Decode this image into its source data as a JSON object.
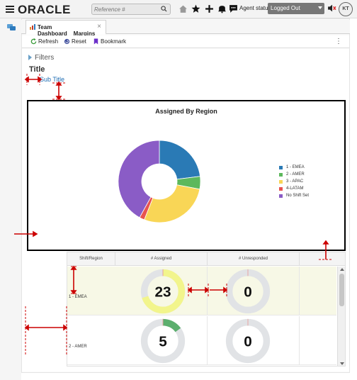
{
  "header": {
    "logo": "ORACLE",
    "search_placeholder": "Reference #",
    "agent_label": "Agent status:",
    "agent_status": "Logged Out",
    "avatar_initials": "KT"
  },
  "tab": {
    "label": "Team Dashboard__Margins",
    "close": "×"
  },
  "toolbar": {
    "refresh": "Refresh",
    "reset": "Reset",
    "bookmark": "Bookmark"
  },
  "filters_label": "Filters",
  "title": "Title",
  "subtitle": "Sub Title",
  "chart_data": {
    "type": "pie",
    "title": "Assigned By Region",
    "donut": true,
    "legend_position": "right",
    "categories": [
      "1 - EMEA",
      "2 - AMER",
      "3 - APAC",
      "4-LATAM",
      "No Shift Set"
    ],
    "values": [
      23,
      5,
      28,
      2,
      42
    ],
    "colors": [
      "#2a7ab5",
      "#5cb85c",
      "#f9d656",
      "#e8534f",
      "#8a5cc6"
    ]
  },
  "table": {
    "headers": [
      "Shift/Region",
      "# Assigned",
      "# Unresponded"
    ],
    "rows": [
      {
        "region": "1 - EMEA",
        "assigned": "23",
        "unresponded": "0",
        "assigned_fill": 0.7,
        "assigned_color": "#f2f58c",
        "highlight": "#f7f8e6"
      },
      {
        "region": "2 - AMER",
        "assigned": "5",
        "unresponded": "0",
        "assigned_fill": 0.15,
        "assigned_color": "#5caf6e",
        "highlight": "#ffffff"
      }
    ]
  }
}
